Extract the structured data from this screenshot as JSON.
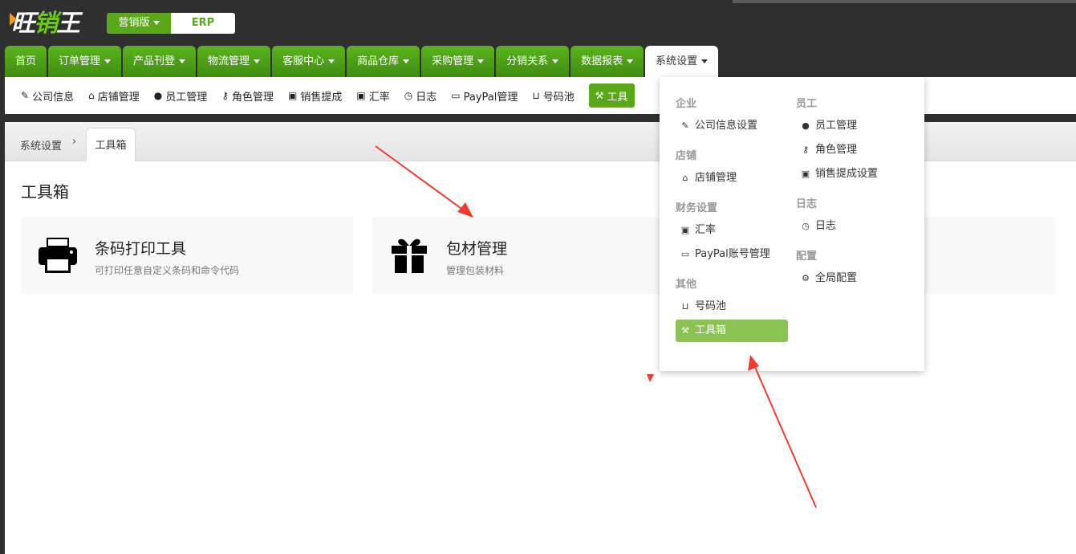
{
  "header": {
    "logo_text_a": "旺",
    "logo_text_b": "销",
    "logo_text_c": "王",
    "edition": "营销版",
    "erp": "ERP"
  },
  "mainnav": [
    {
      "label": "首页",
      "caret": false
    },
    {
      "label": "订单管理",
      "caret": true
    },
    {
      "label": "产品刊登",
      "caret": true
    },
    {
      "label": "物流管理",
      "caret": true
    },
    {
      "label": "客服中心",
      "caret": true
    },
    {
      "label": "商品仓库",
      "caret": true
    },
    {
      "label": "采购管理",
      "caret": true
    },
    {
      "label": "分销关系",
      "caret": true
    },
    {
      "label": "数据报表",
      "caret": true
    },
    {
      "label": "系统设置",
      "caret": true,
      "active": true
    }
  ],
  "subnav": [
    {
      "label": "公司信息",
      "icon": "edit-icon"
    },
    {
      "label": "店铺管理",
      "icon": "home-icon"
    },
    {
      "label": "员工管理",
      "icon": "user-icon"
    },
    {
      "label": "角色管理",
      "icon": "key-icon"
    },
    {
      "label": "销售提成",
      "icon": "money-icon"
    },
    {
      "label": "汇率",
      "icon": "money-icon"
    },
    {
      "label": "日志",
      "icon": "clock-icon"
    },
    {
      "label": "PayPal管理",
      "icon": "card-icon"
    },
    {
      "label": "号码池",
      "icon": "inbox-icon"
    },
    {
      "label": "工具",
      "icon": "gavel-icon",
      "active": true
    }
  ],
  "breadcrumb": {
    "parent": "系统设置",
    "current": "工具箱"
  },
  "page": {
    "title": "工具箱",
    "cards": [
      {
        "title": "条码打印工具",
        "desc": "可打印任意自定义条码和命令代码",
        "icon": "printer-icon"
      },
      {
        "title": "包材管理",
        "desc": "管理包装材料",
        "icon": "gift-icon"
      }
    ]
  },
  "dropdown": {
    "col1": {
      "groups": [
        {
          "head": "企业",
          "items": [
            {
              "label": "公司信息设置",
              "icon": "edit-icon"
            }
          ]
        },
        {
          "head": "店铺",
          "items": [
            {
              "label": "店铺管理",
              "icon": "home-icon"
            }
          ]
        },
        {
          "head": "财务设置",
          "items": [
            {
              "label": "汇率",
              "icon": "money-icon"
            },
            {
              "label": "PayPal账号管理",
              "icon": "card-icon"
            }
          ]
        },
        {
          "head": "其他",
          "items": [
            {
              "label": "号码池",
              "icon": "inbox-icon"
            },
            {
              "label": "工具箱",
              "icon": "gavel-icon",
              "active": true
            }
          ]
        }
      ]
    },
    "col2": {
      "groups": [
        {
          "head": "员工",
          "items": [
            {
              "label": "员工管理",
              "icon": "user-icon"
            },
            {
              "label": "角色管理",
              "icon": "key-icon"
            },
            {
              "label": "销售提成设置",
              "icon": "money-icon"
            }
          ]
        },
        {
          "head": "日志",
          "items": [
            {
              "label": "日志",
              "icon": "clock-icon"
            }
          ]
        },
        {
          "head": "配置",
          "items": [
            {
              "label": "全局配置",
              "icon": "gear-icon"
            }
          ]
        }
      ]
    }
  },
  "colors": {
    "brand_green": "#5aa71a",
    "active_item": "#8ac351",
    "annotation_arrow": "#ee3b2e"
  }
}
